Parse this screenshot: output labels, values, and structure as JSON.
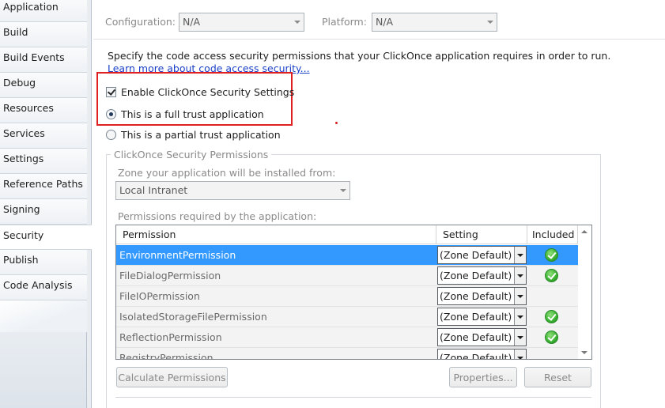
{
  "nav": {
    "items": [
      {
        "label": "Application"
      },
      {
        "label": "Build"
      },
      {
        "label": "Build Events"
      },
      {
        "label": "Debug"
      },
      {
        "label": "Resources"
      },
      {
        "label": "Services"
      },
      {
        "label": "Settings"
      },
      {
        "label": "Reference Paths"
      },
      {
        "label": "Signing"
      },
      {
        "label": "Security"
      },
      {
        "label": "Publish"
      },
      {
        "label": "Code Analysis"
      }
    ],
    "active": "Security"
  },
  "config": {
    "configuration_label": "Configuration:",
    "configuration_value": "N/A",
    "platform_label": "Platform:",
    "platform_value": "N/A"
  },
  "main": {
    "description": "Specify the code access security permissions that your ClickOnce application requires in order to run.",
    "learn_more_link": "Learn more about code access security...",
    "enable_checkbox_label": "Enable ClickOnce Security Settings",
    "enable_checked": true,
    "full_trust_label": "This is a full trust application",
    "partial_trust_label": "This is a partial trust application",
    "trust_selected": "full"
  },
  "permissions_group": {
    "title": "ClickOnce Security Permissions",
    "zone_label": "Zone your application will be installed from:",
    "zone_value": "Local Intranet",
    "permissions_label": "Permissions required by the application:",
    "columns": [
      "Permission",
      "Setting",
      "Included"
    ],
    "rows": [
      {
        "permission": "EnvironmentPermission",
        "setting": "(Zone Default)",
        "included": true,
        "selected": true
      },
      {
        "permission": "FileDialogPermission",
        "setting": "(Zone Default)",
        "included": true,
        "selected": false
      },
      {
        "permission": "FileIOPermission",
        "setting": "(Zone Default)",
        "included": false,
        "selected": false
      },
      {
        "permission": "IsolatedStorageFilePermission",
        "setting": "(Zone Default)",
        "included": true,
        "selected": false
      },
      {
        "permission": "ReflectionPermission",
        "setting": "(Zone Default)",
        "included": true,
        "selected": false
      },
      {
        "permission": "RegistryPermission",
        "setting": "(Zone Default)",
        "included": false,
        "selected": false
      }
    ],
    "calculate_button": "Calculate Permissions",
    "properties_button": "Properties...",
    "reset_button": "Reset"
  },
  "colors": {
    "selection": "#3399ff",
    "highlight_box": "#e02020",
    "link": "#1a3fc8",
    "included_icon": "#38b030"
  },
  "icons": {
    "included": "green-check-icon",
    "dropdown": "chevron-down-icon"
  }
}
